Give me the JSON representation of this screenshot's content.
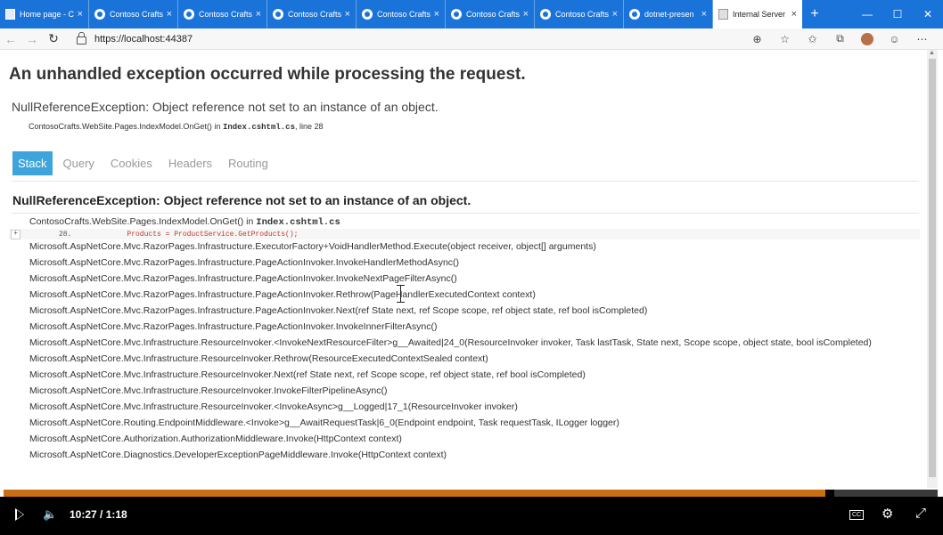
{
  "browser": {
    "tabs": [
      {
        "label": "Home page - C",
        "icon": "page-icon"
      },
      {
        "label": "Contoso Crafts",
        "icon": "github-icon"
      },
      {
        "label": "Contoso Crafts",
        "icon": "github-icon"
      },
      {
        "label": "Contoso Crafts",
        "icon": "github-icon"
      },
      {
        "label": "Contoso Crafts",
        "icon": "github-icon"
      },
      {
        "label": "Contoso Crafts",
        "icon": "github-icon"
      },
      {
        "label": "Contoso Crafts",
        "icon": "github-icon"
      },
      {
        "label": "dotnet-presen",
        "icon": "github-icon"
      },
      {
        "label": "Internal Server",
        "icon": "page-icon"
      }
    ],
    "close_glyph": "×",
    "new_tab_glyph": "+",
    "window_controls": [
      "—",
      "☐",
      "✕"
    ],
    "nav": {
      "back": "←",
      "forward": "→",
      "refresh": "↻"
    },
    "url": "https://localhost:44387",
    "toolbar_glyphs": [
      "⊕",
      "☆",
      "✩",
      "⧉",
      "☺",
      "⋯"
    ]
  },
  "page": {
    "heading": "An unhandled exception occurred while processing the request.",
    "exception_title": "NullReferenceException: Object reference not set to an instance of an object.",
    "location_prefix": "ContosoCrafts.WebSite.Pages.IndexModel.OnGet() in ",
    "location_file": "Index.cshtml.cs",
    "location_suffix": ", line 28",
    "tabs": [
      "Stack",
      "Query",
      "Cookies",
      "Headers",
      "Routing"
    ],
    "stack_heading": "NullReferenceException: Object reference not set to an instance of an object.",
    "first_frame_prefix": "ContosoCrafts.WebSite.Pages.IndexModel.OnGet() in ",
    "first_frame_file": "Index.cshtml.cs",
    "code_line": {
      "expand": "+",
      "number": "28.",
      "text": "Products = ProductService.GetProducts();"
    },
    "frames": [
      "Microsoft.AspNetCore.Mvc.RazorPages.Infrastructure.ExecutorFactory+VoidHandlerMethod.Execute(object receiver, object[] arguments)",
      "Microsoft.AspNetCore.Mvc.RazorPages.Infrastructure.PageActionInvoker.InvokeHandlerMethodAsync()",
      "Microsoft.AspNetCore.Mvc.RazorPages.Infrastructure.PageActionInvoker.InvokeNextPageFilterAsync()",
      "Microsoft.AspNetCore.Mvc.RazorPages.Infrastructure.PageActionInvoker.Rethrow(PageHandlerExecutedContext context)",
      "Microsoft.AspNetCore.Mvc.RazorPages.Infrastructure.PageActionInvoker.Next(ref State next, ref Scope scope, ref object state, ref bool isCompleted)",
      "Microsoft.AspNetCore.Mvc.RazorPages.Infrastructure.PageActionInvoker.InvokeInnerFilterAsync()",
      "Microsoft.AspNetCore.Mvc.Infrastructure.ResourceInvoker.<InvokeNextResourceFilter>g__Awaited|24_0(ResourceInvoker invoker, Task lastTask, State next, Scope scope, object state, bool isCompleted)",
      "Microsoft.AspNetCore.Mvc.Infrastructure.ResourceInvoker.Rethrow(ResourceExecutedContextSealed context)",
      "Microsoft.AspNetCore.Mvc.Infrastructure.ResourceInvoker.Next(ref State next, ref Scope scope, ref object state, ref bool isCompleted)",
      "Microsoft.AspNetCore.Mvc.Infrastructure.ResourceInvoker.InvokeFilterPipelineAsync()",
      "Microsoft.AspNetCore.Mvc.Infrastructure.ResourceInvoker.<InvokeAsync>g__Logged|17_1(ResourceInvoker invoker)",
      "Microsoft.AspNetCore.Routing.EndpointMiddleware.<Invoke>g__AwaitRequestTask|6_0(Endpoint endpoint, Task requestTask, ILogger logger)",
      "Microsoft.AspNetCore.Authorization.AuthorizationMiddleware.Invoke(HttpContext context)",
      "Microsoft.AspNetCore.Diagnostics.DeveloperExceptionPageMiddleware.Invoke(HttpContext context)"
    ]
  },
  "player": {
    "progress_percent": 88,
    "time": "10:27  /  1:18",
    "volume_glyph": "🔈",
    "cc_label": "CC",
    "settings_glyph": "⚙",
    "fullscreen_glyph": "⤢",
    "accent_color": "#cc6f13"
  }
}
